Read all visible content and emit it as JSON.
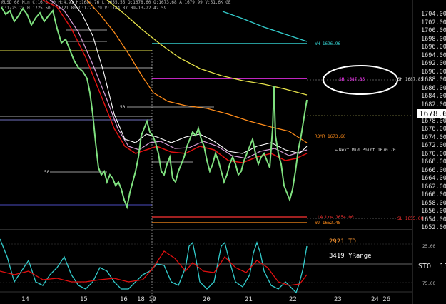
{
  "header": {
    "line1": "@USD  60 Min  C:1678.60  H:4.91  H:1684.76  L:1655.55  O:1678.60  O:1673.68  A:1679.99  V:51.6K  GE",
    "line2": "C:1725.23  H:1725.50  L:1721.80  C:1723.79  V:1784.87  09-13-22  42.59"
  },
  "price_axis": {
    "ticks": [
      "1704.00",
      "1702.00",
      "1700.00",
      "1698.00",
      "1696.00",
      "1694.00",
      "1692.00",
      "1690.00",
      "1688.00",
      "1686.00",
      "1684.00",
      "1682.00",
      "1680.00",
      "1678.00",
      "1676.00",
      "1674.00",
      "1672.00",
      "1670.00",
      "1668.00",
      "1666.00",
      "1664.00",
      "1662.00",
      "1660.00",
      "1658.00",
      "1656.00",
      "1654.00",
      "1652.00"
    ],
    "last_price": "1678.60"
  },
  "x_axis": {
    "ticks": [
      "14",
      "15",
      "16",
      "18 19",
      "20",
      "21",
      "22",
      "23",
      "24 26"
    ]
  },
  "annotations": {
    "wh": "WH 1696.96",
    "sh": "SH 1687.85",
    "sh_inner": "SH 1687.85",
    "rmr": "ROMR 1673.60",
    "next_mid": "Next Mid Point 1670.70",
    "ll_low": "LA Low 1654.00",
    "sl": "SL 1655.00",
    "wj": "WJ 1652.48",
    "fifty": "50",
    "fifty2": "50",
    "td": "2921 TD",
    "yrange": "3419 YRange"
  },
  "indicator": {
    "name": "STO",
    "value": "15.",
    "axis_top": "25.00",
    "axis_bottom": "75.00"
  },
  "colors": {
    "background": "#000000",
    "candle": "#7fe07f",
    "ma_yellow": "#e6e24a",
    "ma_orange": "#ff8c1a",
    "ma_red": "#e01010",
    "ma_white": "#ffffff",
    "ma_pink": "#d8a0d8",
    "cyan": "#33cccc",
    "magenta": "#ff33ff"
  }
}
